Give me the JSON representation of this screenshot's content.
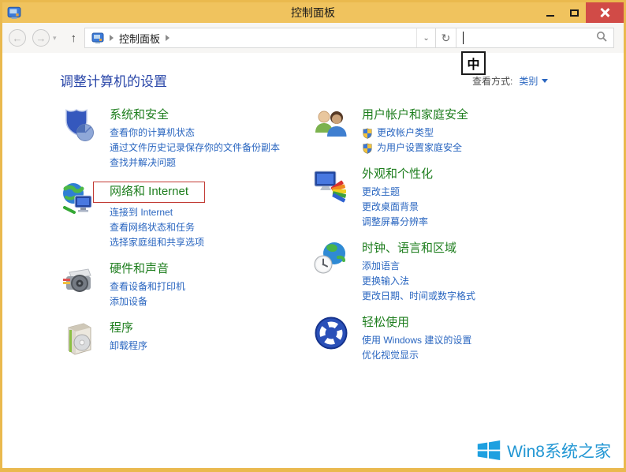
{
  "colors": {
    "titlebar": "#f0c35e",
    "window_border": "#eab94e",
    "close_button": "#d14b47",
    "category_green": "#1e7e1e",
    "link_blue": "#2a66c0",
    "page_heading_blue": "#2946a8",
    "highlight_red": "#c23b34",
    "watermark_blue": "#2196d3"
  },
  "window": {
    "title": "控制面板"
  },
  "navbar": {
    "breadcrumb_root": "控制面板",
    "search_value": ""
  },
  "ime": {
    "indicator": "中"
  },
  "page": {
    "heading": "调整计算机的设置",
    "view_by_label": "查看方式:",
    "view_by_value": "类别"
  },
  "columns": [
    {
      "side": "left",
      "items": [
        {
          "title": "系统和安全",
          "icon": "system-security-icon",
          "highlighted": false,
          "links": [
            {
              "text": "查看你的计算机状态",
              "uac": false
            },
            {
              "text": "通过文件历史记录保存你的文件备份副本",
              "uac": false
            },
            {
              "text": "查找并解决问题",
              "uac": false
            }
          ]
        },
        {
          "title": "网络和 Internet",
          "icon": "network-internet-icon",
          "highlighted": true,
          "links": [
            {
              "text": "连接到 Internet",
              "uac": false
            },
            {
              "text": "查看网络状态和任务",
              "uac": false
            },
            {
              "text": "选择家庭组和共享选项",
              "uac": false
            }
          ]
        },
        {
          "title": "硬件和声音",
          "icon": "hardware-sound-icon",
          "highlighted": false,
          "links": [
            {
              "text": "查看设备和打印机",
              "uac": false
            },
            {
              "text": "添加设备",
              "uac": false
            }
          ]
        },
        {
          "title": "程序",
          "icon": "programs-icon",
          "highlighted": false,
          "links": [
            {
              "text": "卸载程序",
              "uac": false
            }
          ]
        }
      ]
    },
    {
      "side": "right",
      "items": [
        {
          "title": "用户帐户和家庭安全",
          "icon": "user-accounts-icon",
          "highlighted": false,
          "links": [
            {
              "text": "更改帐户类型",
              "uac": true
            },
            {
              "text": "为用户设置家庭安全",
              "uac": true
            }
          ]
        },
        {
          "title": "外观和个性化",
          "icon": "appearance-icon",
          "highlighted": false,
          "links": [
            {
              "text": "更改主题",
              "uac": false
            },
            {
              "text": "更改桌面背景",
              "uac": false
            },
            {
              "text": "调整屏幕分辨率",
              "uac": false
            }
          ]
        },
        {
          "title": "时钟、语言和区域",
          "icon": "clock-language-icon",
          "highlighted": false,
          "links": [
            {
              "text": "添加语言",
              "uac": false
            },
            {
              "text": "更换输入法",
              "uac": false
            },
            {
              "text": "更改日期、时间或数字格式",
              "uac": false
            }
          ]
        },
        {
          "title": "轻松使用",
          "icon": "ease-of-access-icon",
          "highlighted": false,
          "links": [
            {
              "text": "使用 Windows 建议的设置",
              "uac": false
            },
            {
              "text": "优化视觉显示",
              "uac": false
            }
          ]
        }
      ]
    }
  ],
  "watermark": {
    "text": "Win8系统之家"
  }
}
